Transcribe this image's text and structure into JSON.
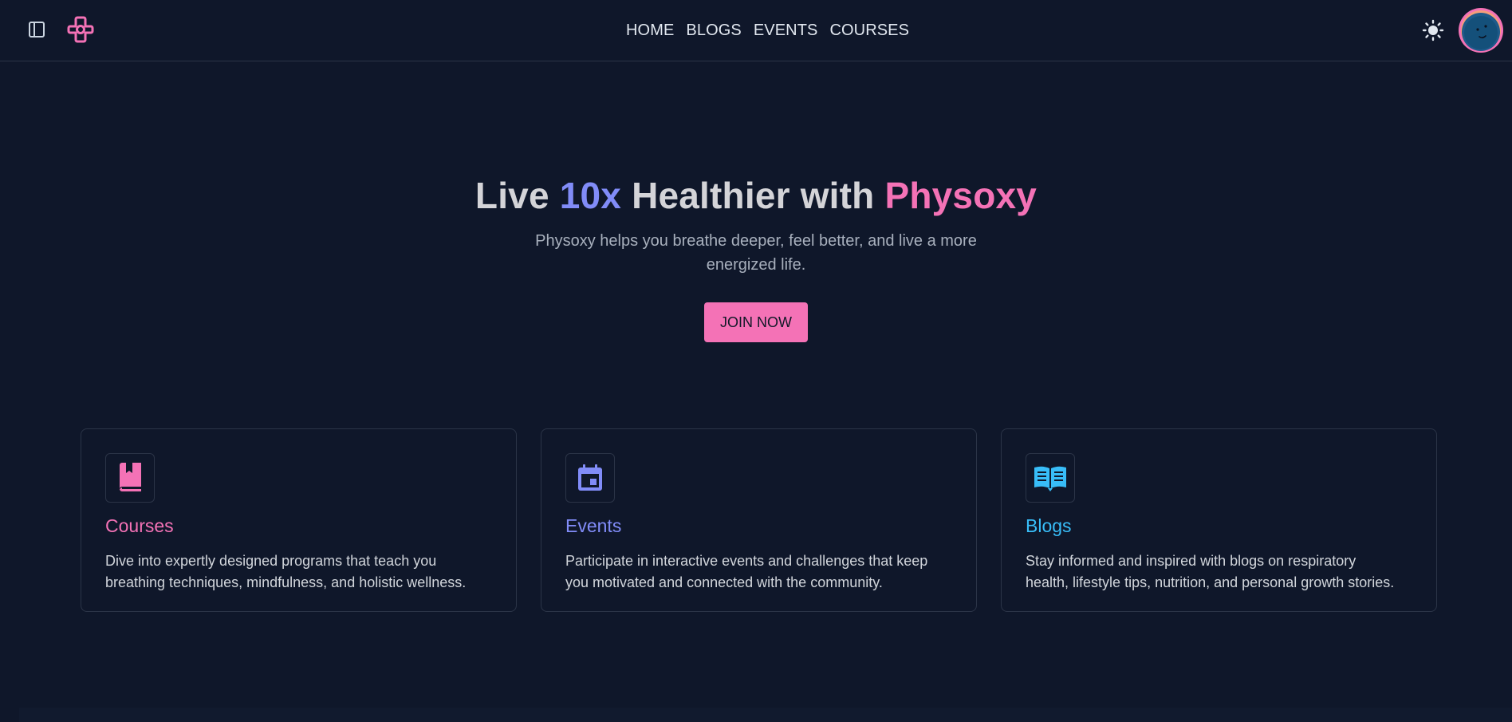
{
  "header": {
    "nav": [
      "HOME",
      "BLOGS",
      "EVENTS",
      "COURSES"
    ]
  },
  "hero": {
    "title_part1": "Live ",
    "title_highlight1": "10x",
    "title_part2": " Healthier with ",
    "title_highlight2": "Physoxy",
    "subtitle": "Physoxy helps you breathe deeper, feel better, and live a more energized life.",
    "cta_label": "JOIN NOW"
  },
  "cards": [
    {
      "title": "Courses",
      "description": "Dive into expertly designed programs that teach you breathing techniques, mindfulness, and holistic wellness.",
      "icon": "book-icon",
      "color": "#f472b6"
    },
    {
      "title": "Events",
      "description": "Participate in interactive events and challenges that keep you motivated and connected with the community.",
      "icon": "calendar-icon",
      "color": "#818cf8"
    },
    {
      "title": "Blogs",
      "description": "Stay informed and inspired with blogs on respiratory health, lifestyle tips, nutrition, and personal growth stories.",
      "icon": "open-book-icon",
      "color": "#38bdf8"
    }
  ],
  "colors": {
    "background": "#0f172a",
    "accent_pink": "#f472b6",
    "accent_indigo": "#818cf8",
    "accent_sky": "#38bdf8"
  }
}
